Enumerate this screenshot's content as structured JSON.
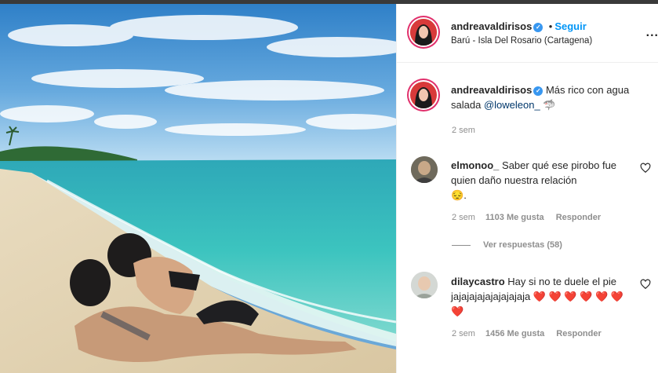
{
  "post": {
    "username": "andreavaldirisos",
    "follow_label": "Seguir",
    "dot": "•",
    "location": "Barú - Isla Del Rosario (Cartagena)",
    "more_label": "..."
  },
  "caption": {
    "username": "andreavaldirisos",
    "text": "Más rico con agua salada",
    "mention": "@loweleon_",
    "emoji": "🦈",
    "time": "2 sem"
  },
  "comments": [
    {
      "username": "elmonoo_",
      "text": "Saber qué ese pirobo fue quien daño nuestra relación",
      "emoji": "😔",
      "trailing": ".",
      "time": "2 sem",
      "likes": "1103 Me gusta",
      "reply_label": "Responder",
      "view_replies": "Ver respuestas (58)"
    },
    {
      "username": "dilaycastro",
      "text": "Hay si no te duele el pie jajajajajajajajajaja",
      "hearts": "❤️ ❤️ ❤️ ❤️ ❤️ ❤️ ❤️",
      "time": "2 sem",
      "likes": "1456 Me gusta",
      "reply_label": "Responder"
    }
  ],
  "colors": {
    "accent": "#0095f6",
    "verified": "#3897f0",
    "heart": "#ed1c24",
    "muted": "#8e8e8e"
  },
  "icons": {
    "verified": "verified-badge-icon",
    "like": "heart-outline-icon",
    "more": "more-options-icon"
  }
}
